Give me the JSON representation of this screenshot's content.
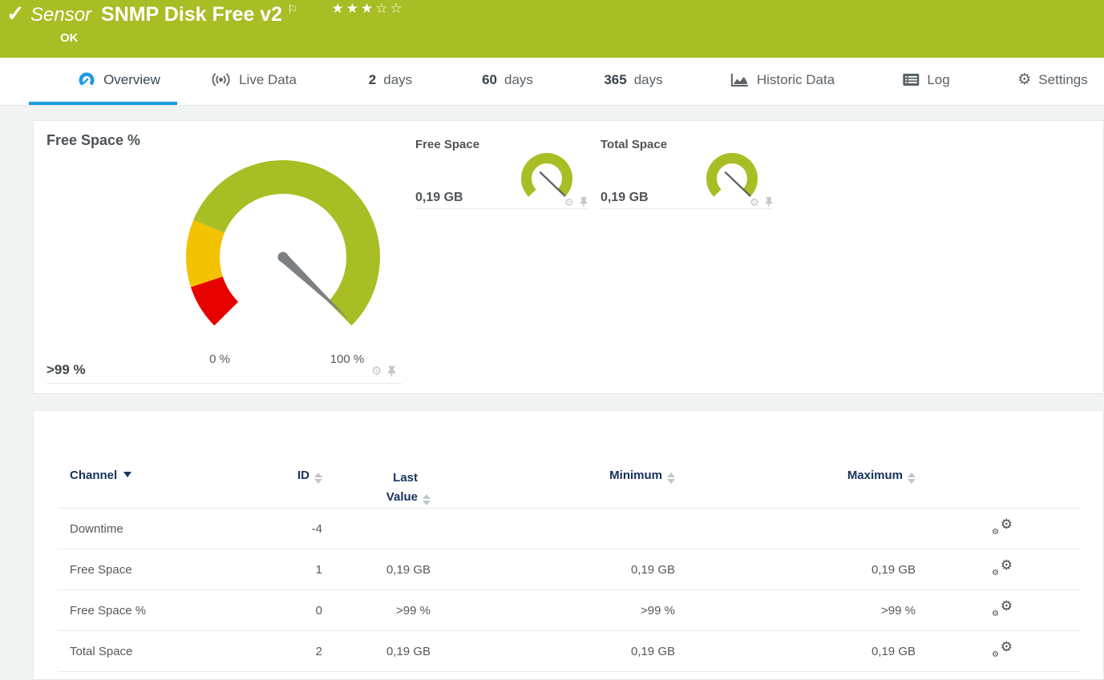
{
  "header": {
    "type_label": "Sensor",
    "title": "SNMP Disk Free v2",
    "status": "OK",
    "stars": "★★★☆☆",
    "flag_glyph": "⚐",
    "check_glyph": "✓",
    "bar_color": "#a9bd24"
  },
  "tabs": [
    {
      "label": "Overview"
    },
    {
      "label": "Live Data"
    },
    {
      "number": "2",
      "label": "days"
    },
    {
      "number": "60",
      "label": "days"
    },
    {
      "number": "365",
      "label": "days"
    },
    {
      "label": "Historic Data"
    },
    {
      "label": "Log"
    },
    {
      "label": "Settings"
    }
  ],
  "icons": {
    "gear_glyph": "⚙"
  },
  "gauges": {
    "main": {
      "title": "Free Space %",
      "value": ">99 %",
      "min_label": "0 %",
      "max_label": "100 %",
      "needle_percent": 99.5,
      "segments": [
        {
          "from": 0,
          "to": 10,
          "color": "#e60000"
        },
        {
          "from": 10,
          "to": 25,
          "color": "#f3c200"
        },
        {
          "from": 25,
          "to": 100,
          "color": "#a9bd24"
        }
      ]
    },
    "mini": [
      {
        "title": "Free Space",
        "value": "0,19 GB",
        "color": "#a9bd24"
      },
      {
        "title": "Total Space",
        "value": "0,19 GB",
        "color": "#a9bd24"
      }
    ]
  },
  "table": {
    "headers": {
      "channel": "Channel",
      "id": "ID",
      "last": "Last Value",
      "min": "Minimum",
      "max": "Maximum"
    },
    "rows": [
      {
        "channel": "Downtime",
        "id": "-4",
        "last": "",
        "min": "",
        "max": ""
      },
      {
        "channel": "Free Space",
        "id": "1",
        "last": "0,19 GB",
        "min": "0,19 GB",
        "max": "0,19 GB"
      },
      {
        "channel": "Free Space %",
        "id": "0",
        "last": ">99 %",
        "min": ">99 %",
        "max": ">99 %"
      },
      {
        "channel": "Total Space",
        "id": "2",
        "last": "0,19 GB",
        "min": "0,19 GB",
        "max": "0,19 GB"
      }
    ]
  }
}
